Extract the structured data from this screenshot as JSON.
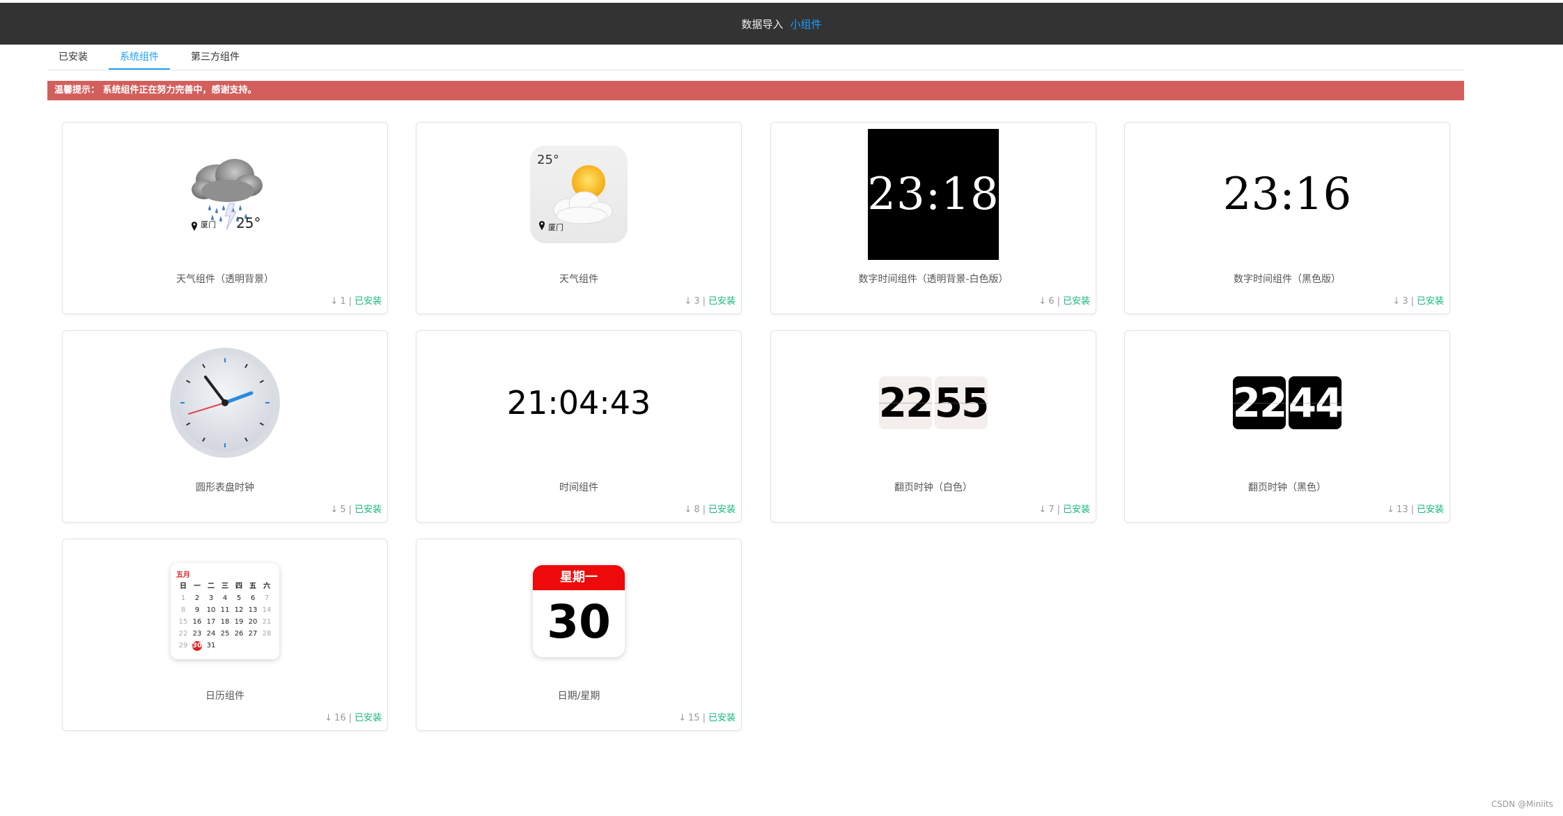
{
  "header": {
    "crumb_1": "数据导入",
    "crumb_2": "小组件"
  },
  "tabs": [
    {
      "label": "已安装",
      "active": false
    },
    {
      "label": "系统组件",
      "active": true
    },
    {
      "label": "第三方组件",
      "active": false
    }
  ],
  "notice": {
    "text": "温馨提示：  系统组件正在努力完善中，感谢支持。"
  },
  "colors": {
    "accent": "#1e9fff",
    "installed": "#16b777",
    "notice_bg": "#d25f5c",
    "topbar_bg": "#333333"
  },
  "cards": [
    {
      "title": "天气组件（透明背景）",
      "downloads": "1",
      "status": "已安装",
      "icon": "rain-cloud-icon",
      "preview": {
        "location": "厦门",
        "temp": "25°"
      }
    },
    {
      "title": "天气组件",
      "downloads": "3",
      "status": "已安装",
      "icon": "sun-cloud-icon",
      "preview": {
        "location": "厦门",
        "temp": "25°"
      }
    },
    {
      "title": "数字时间组件（透明背景-白色版）",
      "downloads": "6",
      "status": "已安装",
      "preview": {
        "time": "23:18"
      }
    },
    {
      "title": "数字时间组件（黑色版）",
      "downloads": "3",
      "status": "已安装",
      "preview": {
        "time": "23:16"
      }
    },
    {
      "title": "圆形表盘时钟",
      "downloads": "5",
      "status": "已安装",
      "icon": "analog-clock-icon"
    },
    {
      "title": "时间组件",
      "downloads": "8",
      "status": "已安装",
      "preview": {
        "time": "21:04:43"
      }
    },
    {
      "title": "翻页时钟（白色）",
      "downloads": "7",
      "status": "已安装",
      "preview": {
        "hour": "22",
        "minute": "55"
      }
    },
    {
      "title": "翻页时钟（黑色）",
      "downloads": "13",
      "status": "已安装",
      "preview": {
        "hour": "22",
        "minute": "44"
      }
    },
    {
      "title": "日历组件",
      "downloads": "16",
      "status": "已安装",
      "preview": {
        "month": "五月",
        "weekdays": [
          "日",
          "一",
          "二",
          "三",
          "四",
          "五",
          "六"
        ],
        "days": [
          "1",
          "2",
          "3",
          "4",
          "5",
          "6",
          "7",
          "8",
          "9",
          "10",
          "11",
          "12",
          "13",
          "14",
          "15",
          "16",
          "17",
          "18",
          "19",
          "20",
          "21",
          "22",
          "23",
          "24",
          "25",
          "26",
          "27",
          "28",
          "29",
          "30",
          "31"
        ],
        "today": "30"
      }
    },
    {
      "title": "日期/星期",
      "downloads": "15",
      "status": "已安装",
      "preview": {
        "weekday": "星期一",
        "day": "30"
      }
    }
  ],
  "watermark": "CSDN @Miniits"
}
